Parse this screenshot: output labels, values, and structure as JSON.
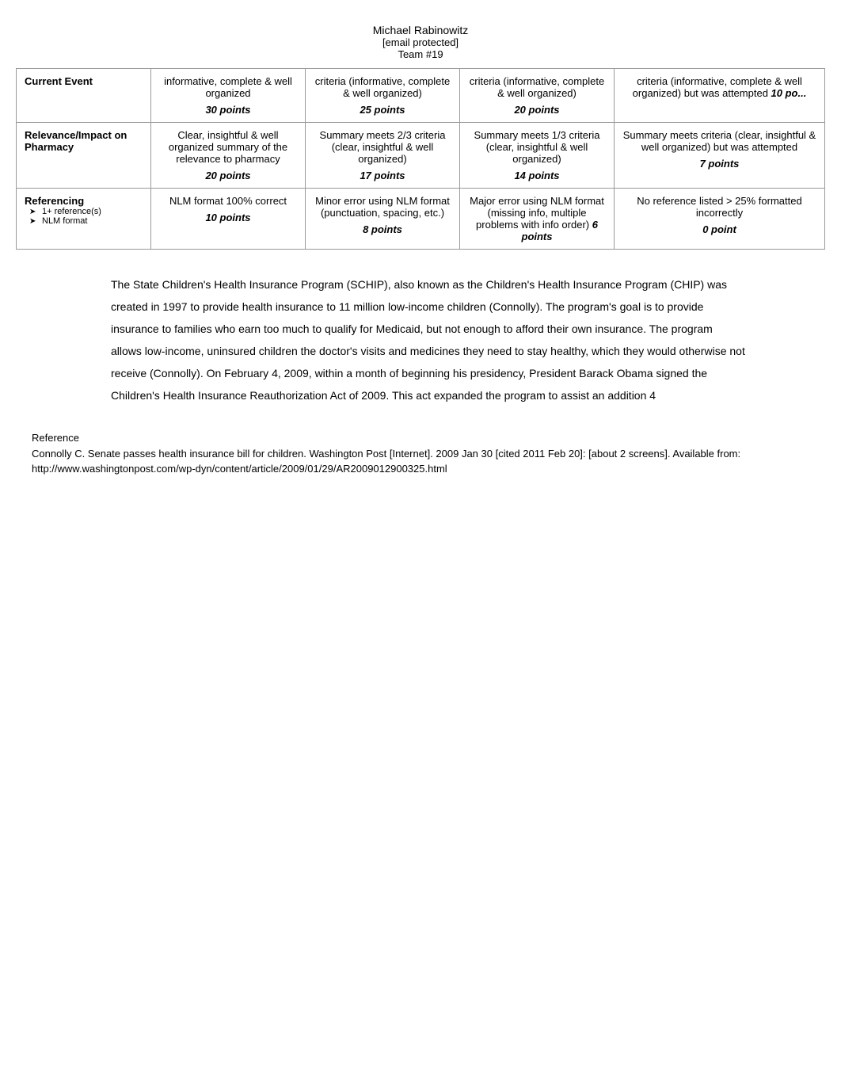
{
  "header": {
    "name": "Michael Rabinowitz",
    "email": "[email protected]",
    "team": "Team #19"
  },
  "table": {
    "rows": [
      {
        "criterion": "Current Event",
        "col1_text": "informative, complete & well organized",
        "col1_points": "30 points",
        "col2_text": "criteria (informative, complete & well organized)",
        "col2_points": "25 points",
        "col3_text": "criteria (informative, complete & well organized)",
        "col3_points": "20 points",
        "col4_text": "criteria (informative, complete & well organized) but was attempted",
        "col4_points": "10 po..."
      },
      {
        "criterion": "Relevance/Impact on Pharmacy",
        "col1_text": "Clear, insightful & well organized summary of the relevance to pharmacy",
        "col1_points": "20 points",
        "col2_text": "Summary meets 2/3 criteria (clear, insightful & well organized)",
        "col2_points": "17 points",
        "col3_text": "Summary meets 1/3 criteria (clear, insightful & well organized)",
        "col3_points": "14 points",
        "col4_text": "Summary meets criteria (clear, insightful & well organized) but was attempted",
        "col4_points": "7 points"
      },
      {
        "criterion": "Referencing",
        "criterion_sub1": "1+ reference(s)",
        "criterion_sub2": "NLM format",
        "col1_text": "NLM format 100% correct",
        "col1_points": "10 points",
        "col2_text": "Minor error using NLM format (punctuation, spacing, etc.)",
        "col2_points": "8 points",
        "col3_text": "Major error using NLM format (missing info, multiple problems with info order)",
        "col3_points": "6 points",
        "col4_text": "No reference listed > 25% formatted incorrectly",
        "col4_points": "0 point"
      }
    ]
  },
  "body_text": "The State Children's Health Insurance Program (SCHIP), also known as the Children's Health Insurance Program (CHIP) was created in 1997 to provide health insurance to 11 million low-income children (Connolly). The program's goal is to provide insurance to families who earn too much to qualify for Medicaid, but not enough to afford their own insurance. The program allows low-income, uninsured children the doctor's visits and medicines they need to stay healthy, which they would otherwise not receive (Connolly). On February 4, 2009, within a month of beginning his presidency, President Barack Obama signed the Children's Health Insurance Reauthorization Act of 2009. This act expanded the program to assist an addition 4",
  "reference_section": {
    "title": "Reference",
    "entry": "Connolly C. Senate passes health insurance bill for children. Washington Post [Internet]. 2009 Jan 30 [cited 2011 Feb 20]: [about 2 screens]. Available from: http://www.washingtonpost.com/wp-dyn/content/article/2009/01/29/AR2009012900325.html"
  }
}
